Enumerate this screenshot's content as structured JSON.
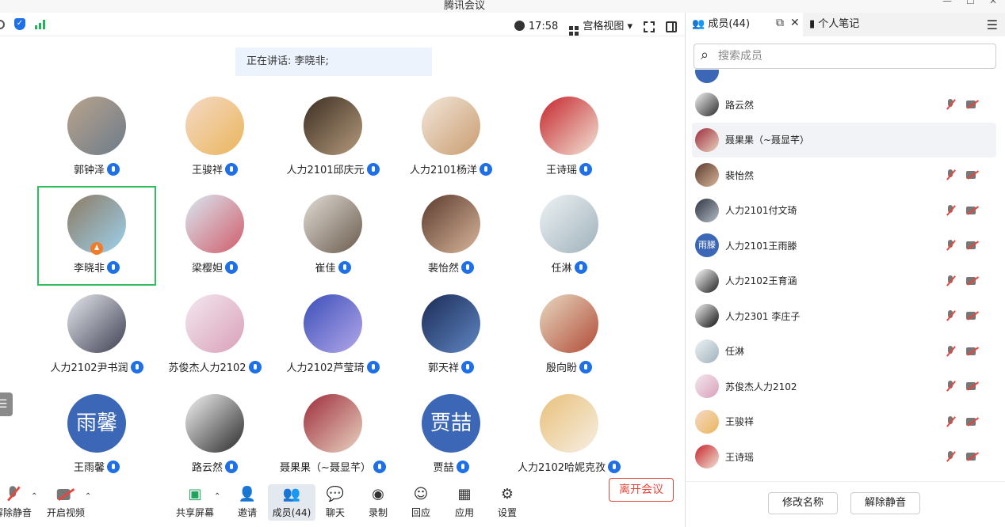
{
  "window": {
    "title": "腾讯会议",
    "controls": [
      "—",
      "☐",
      "✕"
    ]
  },
  "topbar": {
    "time": "17:58",
    "view_label": "宫格视图"
  },
  "speaking": "正在讲话: 李晓非;",
  "participants": [
    {
      "name": "郭钟泽",
      "bg": "linear-gradient(135deg,#b9a48d,#6d7b8a)"
    },
    {
      "name": "王骏祥",
      "bg": "linear-gradient(135deg,#f6d9c6,#e9b65c)"
    },
    {
      "name": "人力2101邱庆元",
      "bg": "linear-gradient(135deg,#3c2e22,#b49a7c)"
    },
    {
      "name": "人力2101杨洋",
      "bg": "linear-gradient(135deg,#f2e7db,#c99c6f)"
    },
    {
      "name": "王诗瑶",
      "bg": "linear-gradient(135deg,#c6252c,#f1e4d6)"
    },
    {
      "name": "李晓非",
      "bg": "linear-gradient(135deg,#8c7a62,#9dd2ef)"
    },
    {
      "name": "梁樱妲",
      "bg": "linear-gradient(135deg,#d8e8f2,#d15c6a)"
    },
    {
      "name": "崔佳",
      "bg": "linear-gradient(135deg,#e2ddd6,#6a5b4d)"
    },
    {
      "name": "裴怡然",
      "bg": "linear-gradient(135deg,#5b3a2e,#d8b69a)"
    },
    {
      "name": "任淋",
      "bg": "linear-gradient(135deg,#eef3f5,#9fb1bb)"
    },
    {
      "name": "人力2102尹书润",
      "bg": "linear-gradient(135deg,#e6e8ee,#3e3f52)"
    },
    {
      "name": "苏俊杰人力2102",
      "bg": "linear-gradient(135deg,#f3e8ef,#d9a0b9)"
    },
    {
      "name": "人力2102芦莹琦",
      "bg": "linear-gradient(135deg,#3a4fb9,#b4a7e9)"
    },
    {
      "name": "郭天祥",
      "bg": "linear-gradient(135deg,#1b2b56,#5f86c3)"
    },
    {
      "name": "殷向盼",
      "bg": "linear-gradient(135deg,#e8d9c2,#b14b36)"
    },
    {
      "name": "王雨馨",
      "text": "雨馨"
    },
    {
      "name": "路云然",
      "bg": "linear-gradient(135deg,#f4f4f4,#2a2a2a)"
    },
    {
      "name": "聂果果（~聂显芊）",
      "bg": "linear-gradient(135deg,#9e2c3a,#e8d3c1)"
    },
    {
      "name": "贾喆",
      "text": "贾喆"
    },
    {
      "name": "人力2102哈妮克孜",
      "bg": "linear-gradient(135deg,#e9c07a,#f6efe3)"
    }
  ],
  "toolbar": {
    "mute": "解除静音",
    "video": "开启视频",
    "share": "共享屏幕",
    "invite": "邀请",
    "members": "成员(44)",
    "chat": "聊天",
    "record": "录制",
    "reaction": "回应",
    "apps": "应用",
    "settings": "设置",
    "leave": "离开会议"
  },
  "side": {
    "tab_members": "成员(44)",
    "tab_notes": "个人笔记",
    "search_placeholder": "搜索成员",
    "rows": [
      {
        "name": "路云然",
        "bg": "linear-gradient(135deg,#f4f4f4,#2a2a2a)"
      },
      {
        "name": "聂果果（~聂显芊）",
        "bg": "linear-gradient(135deg,#9e2c3a,#e8d3c1)",
        "selected": true
      },
      {
        "name": "裴怡然",
        "bg": "linear-gradient(135deg,#5b3a2e,#d8b69a)"
      },
      {
        "name": "人力2101付文琦",
        "bg": "linear-gradient(135deg,#2e3440,#b5bcc6)"
      },
      {
        "name": "人力2101王雨滕",
        "text": "雨滕"
      },
      {
        "name": "人力2102王育涵",
        "bg": "linear-gradient(135deg,#ffffff,#1f1f1f)"
      },
      {
        "name": "人力2301 李庄子",
        "bg": "linear-gradient(135deg,#f2f2f2,#111111)"
      },
      {
        "name": "任淋",
        "bg": "linear-gradient(135deg,#eef3f5,#9fb1bb)"
      },
      {
        "name": "苏俊杰人力2102",
        "bg": "linear-gradient(135deg,#f3e8ef,#d9a0b9)"
      },
      {
        "name": "王骏祥",
        "bg": "linear-gradient(135deg,#f6d9c6,#e9b65c)"
      },
      {
        "name": "王诗瑶",
        "bg": "linear-gradient(135deg,#c6252c,#f1e4d6)"
      }
    ],
    "btn_rename": "修改名称",
    "btn_unmute_all": "解除静音"
  },
  "colors": {
    "accent": "#1e6fe8",
    "active_speaker_border": "#2dbf5b",
    "leave": "#e8453c"
  }
}
